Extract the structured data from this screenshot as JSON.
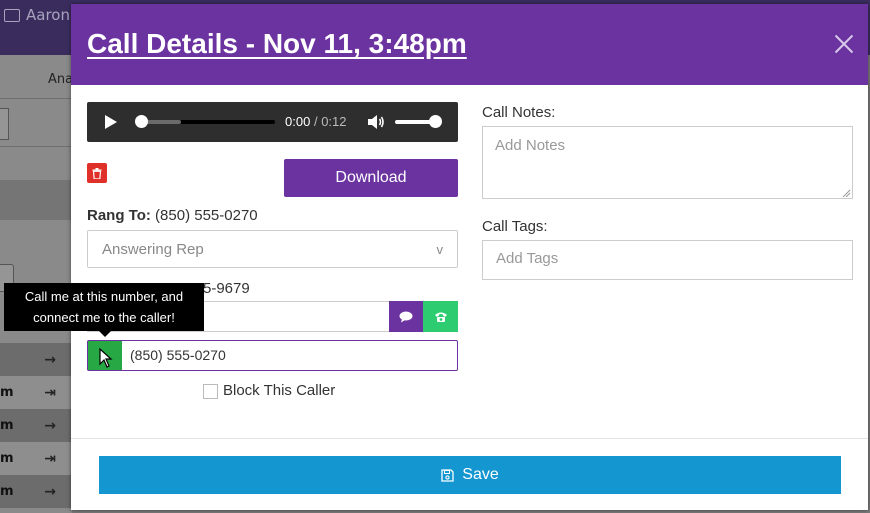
{
  "background": {
    "user_name": "Aaron",
    "tab_fragment": "Ana",
    "rows": [
      "",
      "m",
      "m",
      "m",
      "m"
    ]
  },
  "modal": {
    "title": "Call Details - Nov 11, 3:48pm",
    "audio": {
      "current_time": "0:00",
      "separator": "/",
      "total_time": "0:12"
    },
    "download_label": "Download",
    "rang_to_label": "Rang To:",
    "rang_to_value": "(850) 555-0270",
    "select_value": "Answering Rep",
    "caller_partial": "5-9679",
    "tooltip": {
      "line1": "Call me at this number, and",
      "line2": "connect me to the caller!"
    },
    "callme_number": "(850) 555-0270",
    "block_label": "Block This Caller",
    "notes_label": "Call Notes:",
    "notes_placeholder": "Add Notes",
    "tags_label": "Call Tags:",
    "tags_placeholder": "Add Tags",
    "save_label": "Save"
  },
  "colors": {
    "brand": "#6b33a0",
    "save": "#1496d0",
    "green": "#2ecc71",
    "delete": "#e0302a"
  }
}
